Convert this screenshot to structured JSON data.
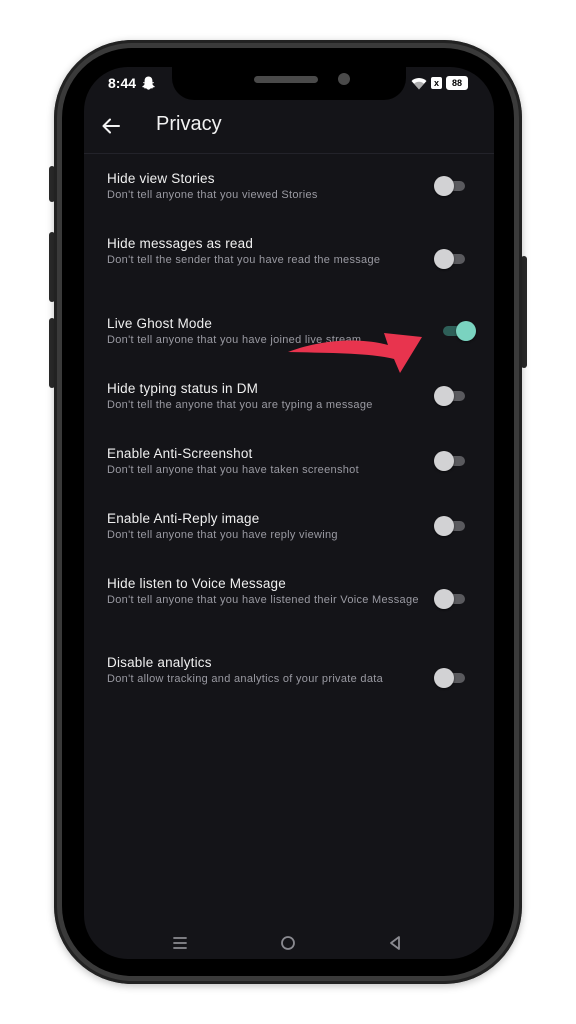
{
  "status_bar": {
    "time": "8:44",
    "battery": "88",
    "sim_indicator": "x"
  },
  "header": {
    "title": "Privacy",
    "back_icon": "arrow-left-icon"
  },
  "settings": [
    {
      "title": "Hide view Stories",
      "description": "Don't tell anyone that you viewed Stories",
      "enabled": false
    },
    {
      "title": "Hide messages as read",
      "description": "Don't tell the sender that you have read the message",
      "enabled": false
    },
    {
      "title": "Live Ghost Mode",
      "description": "Don't tell anyone that you have joined live stream",
      "enabled": true
    },
    {
      "title": "Hide typing status in DM",
      "description": "Don't tell the anyone that you are typing a message",
      "enabled": false
    },
    {
      "title": "Enable Anti-Screenshot",
      "description": "Don't tell anyone that you have taken screenshot",
      "enabled": false
    },
    {
      "title": "Enable Anti-Reply image",
      "description": "Don't tell anyone that you have reply viewing",
      "enabled": false
    },
    {
      "title": "Hide listen to Voice Message",
      "description": "Don't tell anyone that you have listened their Voice Message",
      "enabled": false
    },
    {
      "title": "Disable analytics",
      "description": "Don't allow tracking and analytics of your private data",
      "enabled": false
    }
  ],
  "nav_bar": {
    "icons": [
      "menu-icon",
      "home-circle-icon",
      "back-triangle-icon"
    ]
  },
  "colors": {
    "toggle_on": "#7ad3c0",
    "toggle_off": "#d2d2d4",
    "arrow": "#e8344e",
    "background": "#141418"
  }
}
